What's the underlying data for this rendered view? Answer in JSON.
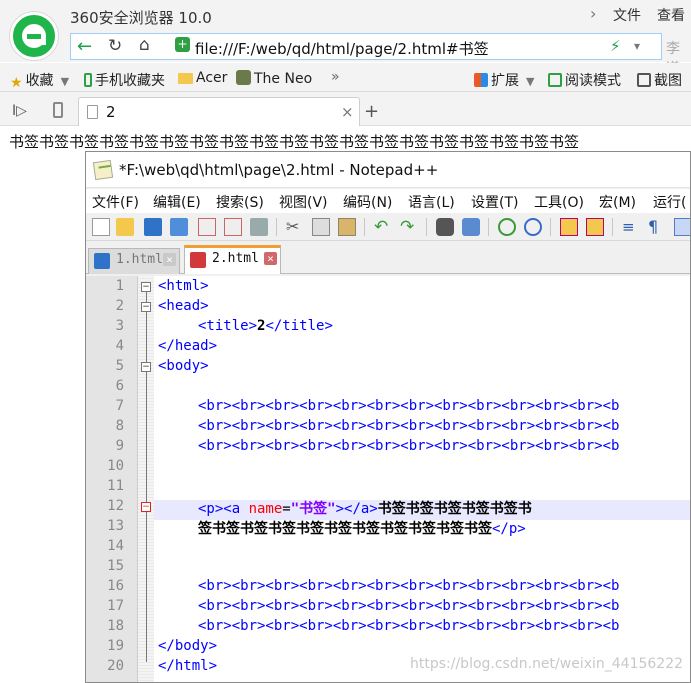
{
  "browser": {
    "title": "360安全浏览器 10.0",
    "menu_file": "文件",
    "menu_view": "查看",
    "url": "file:///F:/web/qd/html/page/2.html#书签",
    "search_placeholder": "李道",
    "bookmarks": {
      "favorites": "收藏",
      "mobile": "手机收藏夹",
      "acer": "Acer",
      "neo": "The Neo",
      "more": "»",
      "extensions": "扩展",
      "reading_mode": "阅读模式",
      "screenshot": "截图"
    },
    "tab_title": "2",
    "page_text": "书签书签书签书签书签书签书签书签书签书签书签书签书签书签书签书签书签书签书签"
  },
  "notepad": {
    "title": "*F:\\web\\qd\\html\\page\\2.html - Notepad++",
    "menu": [
      "文件(F)",
      "编辑(E)",
      "搜索(S)",
      "视图(V)",
      "编码(N)",
      "语言(L)",
      "设置(T)",
      "工具(O)",
      "宏(M)",
      "运行("
    ],
    "tabs": [
      "1.html",
      "2.html"
    ],
    "line_numbers": [
      "1",
      "2",
      "3",
      "4",
      "5",
      "6",
      "7",
      "8",
      "9",
      "10",
      "11",
      "12",
      "13",
      "14",
      "15",
      "16",
      "17",
      "18",
      "19",
      "20"
    ],
    "code": {
      "l1": "<html>",
      "l2": "<head>",
      "l3_open": "<title>",
      "l3_text": "2",
      "l3_close": "</title>",
      "l4": "</head>",
      "l5": "<body>",
      "br_line": "<br><br><br><br><br><br><br><br><br><br><br><br><b",
      "l12_p": "<p><a ",
      "l12_attr": "name",
      "l12_eq": "=",
      "l12_val": "\"书签\"",
      "l12_close": "></a>",
      "l12_text": "书签书签书签书签书签书",
      "l13_text": "签书签书签书签书签书签书签书签书签书签书签",
      "l13_close": "</p>",
      "l19": "</body>",
      "l20": "</html>"
    }
  },
  "watermark": "https://blog.csdn.net/weixin_44156222",
  "colors": {
    "accent_green": "#1fb54a",
    "tag_blue": "#0000ff",
    "attr_red": "#ff0000",
    "string_purple": "#8000ff"
  }
}
